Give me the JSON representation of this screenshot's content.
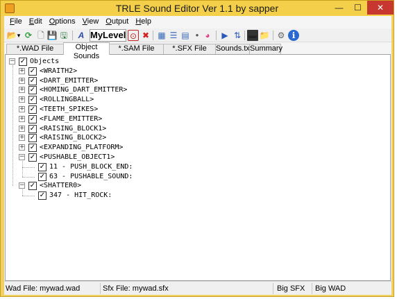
{
  "window": {
    "title": "TRLE Sound Editor Ver 1.1 by sapper",
    "minimize": "—",
    "maximize": "☐",
    "close": "✕"
  },
  "menu": {
    "items": [
      {
        "label": "File",
        "mnemonic": "F",
        "rest": "ile"
      },
      {
        "label": "Edit",
        "mnemonic": "E",
        "rest": "dit"
      },
      {
        "label": "Options",
        "mnemonic": "O",
        "rest": "ptions"
      },
      {
        "label": "View",
        "mnemonic": "V",
        "rest": "iew"
      },
      {
        "label": "Output",
        "mnemonic": "O",
        "rest": "utput"
      },
      {
        "label": "Help",
        "mnemonic": "H",
        "rest": "elp"
      }
    ]
  },
  "toolbar": {
    "level_name": "MyLevel",
    "icons": {
      "open": "📂",
      "dropdown": "▾",
      "refresh": "⟳",
      "new": "🗋",
      "save": "💾",
      "save_as": "🖫",
      "font": "A",
      "record": "⊙",
      "delete": "✖",
      "grid": "▦",
      "list": "☰",
      "details": "▤",
      "dot": "●",
      "palette": "◕",
      "play": "▶",
      "sort": "⇅",
      "console": "▬",
      "folder": "📁",
      "settings": "⚙",
      "info": "ℹ"
    }
  },
  "tabs": [
    {
      "label": "*.WAD File Sounds",
      "active": false
    },
    {
      "label": "Object Sounds",
      "active": true
    },
    {
      "label": "*.SAM File Names",
      "active": false
    },
    {
      "label": "*.SFX File Sounds",
      "active": false
    },
    {
      "label": "Sounds.txt",
      "active": false
    },
    {
      "label": "Summary",
      "active": false
    }
  ],
  "tree": {
    "expander_collapsed": "+",
    "expander_expanded": "−",
    "check_mark": "✓",
    "root": {
      "label": "Objects",
      "checked": true,
      "expanded": true
    },
    "objects": [
      {
        "label": "<WRAITH2>",
        "checked": true,
        "expanded": false,
        "children": []
      },
      {
        "label": "<DART_EMITTER>",
        "checked": true,
        "expanded": false,
        "children": []
      },
      {
        "label": "<HOMING_DART_EMITTER>",
        "checked": true,
        "expanded": false,
        "children": []
      },
      {
        "label": "<ROLLINGBALL>",
        "checked": true,
        "expanded": false,
        "children": []
      },
      {
        "label": "<TEETH_SPIKES>",
        "checked": true,
        "expanded": false,
        "children": []
      },
      {
        "label": "<FLAME_EMITTER>",
        "checked": true,
        "expanded": false,
        "children": []
      },
      {
        "label": "<RAISING_BLOCK1>",
        "checked": true,
        "expanded": false,
        "children": []
      },
      {
        "label": "<RAISING_BLOCK2>",
        "checked": true,
        "expanded": false,
        "children": []
      },
      {
        "label": "<EXPANDING_PLATFORM>",
        "checked": true,
        "expanded": false,
        "children": []
      },
      {
        "label": "<PUSHABLE_OBJECT1>",
        "checked": true,
        "expanded": true,
        "children": [
          {
            "label": "11 - PUSH_BLOCK_END:",
            "checked": true
          },
          {
            "label": "63 - PUSHABLE_SOUND:",
            "checked": true
          }
        ]
      },
      {
        "label": "<SHATTER0>",
        "checked": true,
        "expanded": true,
        "children": [
          {
            "label": "347 - HIT_ROCK:",
            "checked": true
          }
        ]
      }
    ]
  },
  "status": {
    "wad_file": "Wad File: mywad.wad",
    "sfx_file": "Sfx File: mywad.sfx",
    "big_sfx": "Big SFX",
    "big_wad": "Big WAD"
  }
}
